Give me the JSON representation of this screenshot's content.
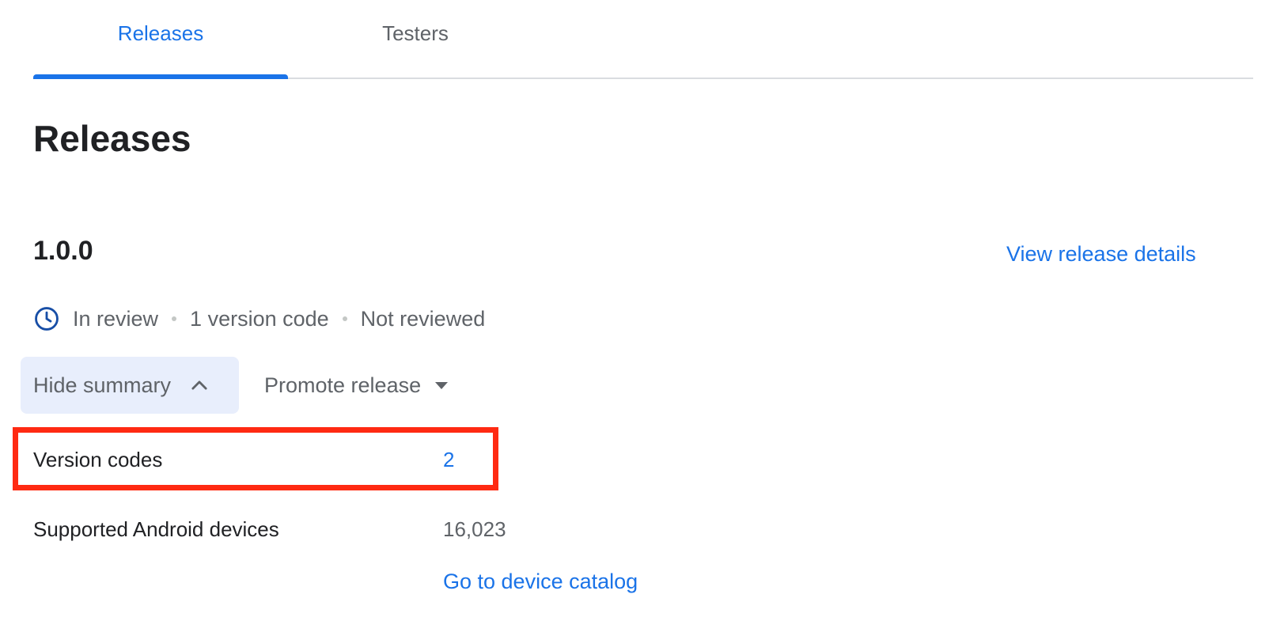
{
  "tabs": [
    {
      "label": "Releases",
      "active": true
    },
    {
      "label": "Testers",
      "active": false
    }
  ],
  "page_title": "Releases",
  "release": {
    "version": "1.0.0",
    "view_details_label": "View release details",
    "status": {
      "icon": "clock-icon",
      "review_state": "In review",
      "version_code_count": "1 version code",
      "reviewed_state": "Not reviewed"
    },
    "hide_summary_label": "Hide summary",
    "promote_label": "Promote release"
  },
  "summary": {
    "version_codes_label": "Version codes",
    "version_codes_value": "2",
    "supported_devices_label": "Supported Android devices",
    "supported_devices_value": "16,023",
    "device_catalog_link": "Go to device catalog"
  },
  "colors": {
    "accent": "#1a73e8",
    "highlight": "#ff2a12",
    "summary_button_bg": "#e8eefc"
  }
}
